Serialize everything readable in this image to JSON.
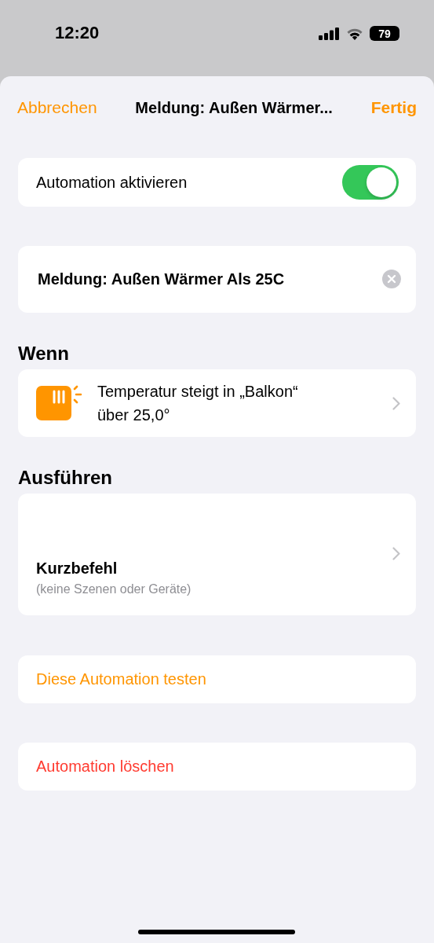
{
  "status_bar": {
    "time": "12:20",
    "battery": "79"
  },
  "nav": {
    "cancel": "Abbrechen",
    "title": "Meldung: Außen Wärmer...",
    "done": "Fertig"
  },
  "enable_row": {
    "label": "Automation aktivieren",
    "on": true
  },
  "name_field": {
    "value": "Meldung: Außen Wärmer Als 25C"
  },
  "trigger_section": {
    "header": "Wenn",
    "trigger": {
      "lines": [
        "Temperatur steigt in „Balkon“",
        "über 25,0°"
      ]
    }
  },
  "action_section": {
    "header": "Ausführen",
    "action": {
      "title": "Kurzbefehl",
      "subtitle": "(keine Szenen oder Geräte)"
    }
  },
  "buttons": [
    {
      "label": "Diese Automation testen",
      "kind": "action"
    },
    {
      "label": "Automation löschen",
      "kind": "destructive"
    }
  ]
}
